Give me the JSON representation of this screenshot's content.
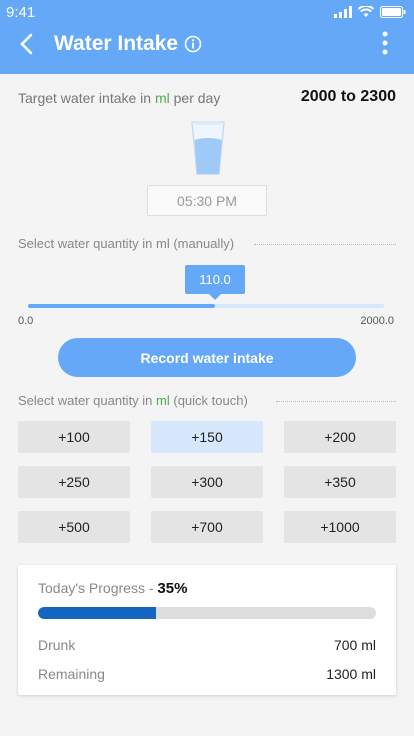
{
  "status": {
    "time": "9:41"
  },
  "header": {
    "title": "Water Intake"
  },
  "target": {
    "label_prefix": "Target water intake in ",
    "label_unit": "ml",
    "label_suffix": " per day",
    "value": "2000 to 2300"
  },
  "time_picker": {
    "value": "05:30 PM"
  },
  "manual": {
    "label": "Select water quantity in ml (manually)",
    "slider_value": "110.0",
    "min_label": "0.0",
    "max_label": "2000.0"
  },
  "record_button": "Record water intake",
  "quick": {
    "label_prefix": "Select water quantity in ",
    "label_unit": "ml",
    "label_suffix": " (quick touch)",
    "buttons": [
      "+100",
      "+150",
      "+200",
      "+250",
      "+300",
      "+350",
      "+500",
      "+700",
      "+1000"
    ],
    "selected": "+150"
  },
  "progress": {
    "title_prefix": "Today's Progress - ",
    "percent_label": "35%",
    "percent": 35,
    "drunk_label": "Drunk",
    "drunk_value": "700 ml",
    "remaining_label": "Remaining",
    "remaining_value": "1300 ml"
  },
  "colors": {
    "primary": "#64a8f7",
    "progress": "#1565c0",
    "accent_green": "#4caf50",
    "selected_button": "#d7e8fc"
  }
}
